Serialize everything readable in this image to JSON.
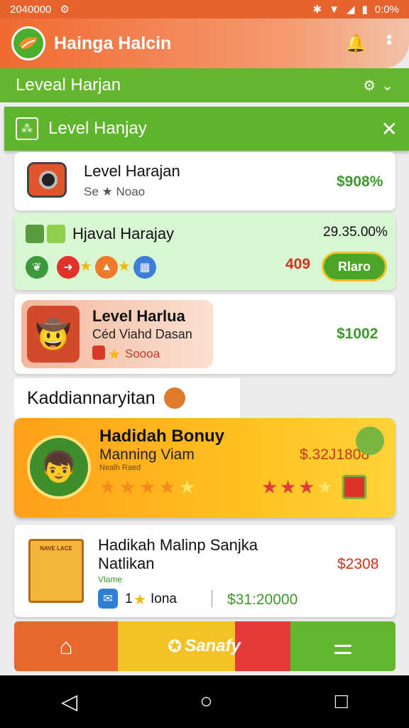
{
  "status_bar": {
    "time": "2040000",
    "battery": "0:0%"
  },
  "app_bar": {
    "title": "Hainga Halcin"
  },
  "level_bar": {
    "label": "Leveal Harjan"
  },
  "banner": {
    "label": "Level Hanjay"
  },
  "items": [
    {
      "title": "Level Harajan",
      "subtitle": "Se ★ Noao",
      "price": "$908%"
    },
    {
      "title": "Hjaval Harajay",
      "price": "29.35.00%",
      "count": "409",
      "button": "Rlaro"
    },
    {
      "title": "Level Harlua",
      "subtitle": "Céd Viahd Dasan",
      "code": "Soooa",
      "price": "$1002"
    }
  ],
  "section": {
    "title": "Kaddiannaryitan"
  },
  "bonus": {
    "title": "Hadidah Bonuy",
    "subtitle": "Manning Viam",
    "small": "Nealh Raed",
    "price": "$.32J1808"
  },
  "item4": {
    "title": "Hadikah Malinp Sanjka",
    "subtitle": "Natlikan",
    "tag": "Vlame",
    "count": "1",
    "count_label": "Iona",
    "price": "$2308",
    "price2": "$31:20000",
    "book_label": "NAVE LACE"
  },
  "bottom_nav": {
    "center_label": "Sanafy"
  },
  "colors": {
    "orange": "#e8622d",
    "green": "#66b52f",
    "price_green": "#3a9a2a",
    "price_red": "#d0321c",
    "yellow": "#f3c326"
  }
}
